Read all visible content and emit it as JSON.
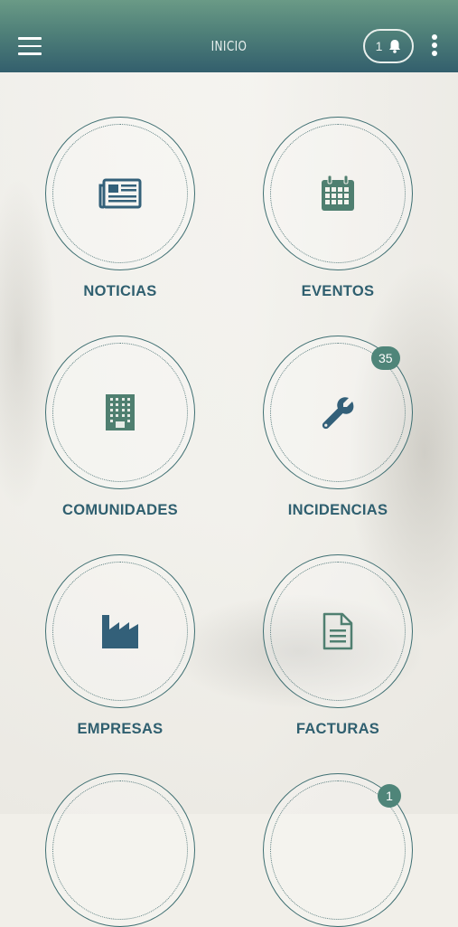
{
  "header": {
    "title": "INICIO",
    "notifications_count": "1",
    "menu_icon": "hamburger-menu-icon",
    "bell_icon": "bell-icon",
    "more_icon": "more-vertical-icon"
  },
  "colors": {
    "header_top": "#6a9a86",
    "header_bottom": "#335f6d",
    "label": "#2f5f6f",
    "icon_green": "#4f7f70",
    "icon_blue": "#336079",
    "badge": "#4f8579"
  },
  "tiles": [
    {
      "label": "NOTICIAS",
      "icon": "newspaper-icon"
    },
    {
      "label": "EVENTOS",
      "icon": "calendar-icon"
    },
    {
      "label": "COMUNIDADES",
      "icon": "building-icon"
    },
    {
      "label": "INCIDENCIAS",
      "icon": "wrench-icon",
      "badge": "35"
    },
    {
      "label": "EMPRESAS",
      "icon": "factory-icon"
    },
    {
      "label": "FACTURAS",
      "icon": "document-icon"
    },
    {
      "label": "",
      "icon": ""
    },
    {
      "label": "",
      "icon": "",
      "badge": "1"
    }
  ]
}
